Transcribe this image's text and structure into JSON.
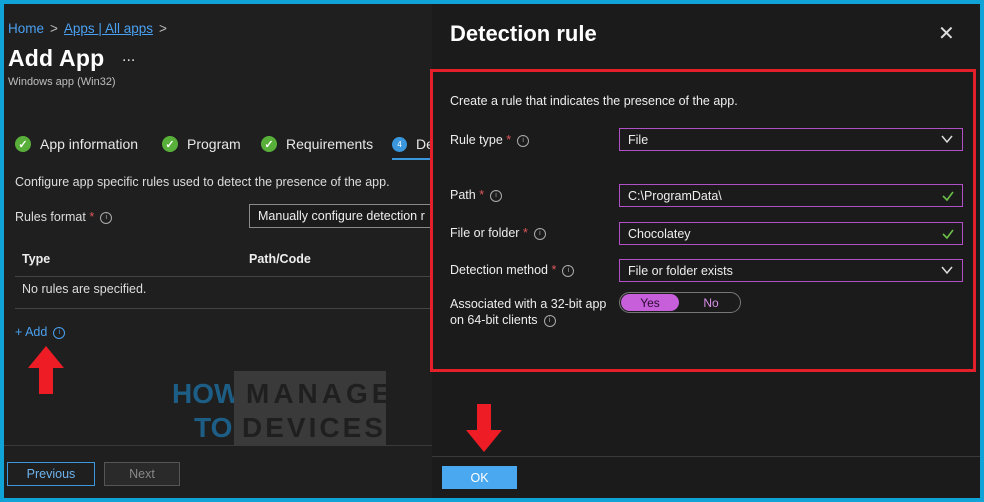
{
  "breadcrumb": {
    "home": "Home",
    "apps": "Apps | All apps",
    "sep": ">"
  },
  "page": {
    "title": "Add App",
    "more": "...",
    "subtitle": "Windows app (Win32)"
  },
  "steps": [
    {
      "label": "App information",
      "state": "done"
    },
    {
      "label": "Program",
      "state": "done"
    },
    {
      "label": "Requirements",
      "state": "done"
    },
    {
      "number": "4",
      "label": "De",
      "state": "current"
    }
  ],
  "main": {
    "description": "Configure app specific rules used to detect the presence of the app.",
    "rules_format_label": "Rules format",
    "rules_format_value": "Manually configure detection r",
    "table_headers": [
      "Type",
      "Path/Code"
    ],
    "empty_text": "No rules are specified.",
    "add_label": "+ Add"
  },
  "logo": {
    "word1_a": "HOW",
    "word1_b": "TO",
    "word2_a": "MANAGE",
    "word2_b": "DEVICES"
  },
  "footer": {
    "previous": "Previous",
    "next": "Next"
  },
  "panel": {
    "title": "Detection rule",
    "close": "✕",
    "intro": "Create a rule that indicates the presence of the app.",
    "rule_type_label": "Rule type",
    "rule_type_value": "File",
    "path_label": "Path",
    "path_value": "C:\\ProgramData\\",
    "file_label": "File or folder",
    "file_value": "Chocolatey",
    "method_label": "Detection method",
    "method_value": "File or folder exists",
    "assoc_label_1": "Associated with a 32-bit app",
    "assoc_label_2": "on 64-bit clients",
    "toggle_yes": "Yes",
    "toggle_no": "No",
    "toggle_selected": "Yes",
    "ok": "OK"
  },
  "colors": {
    "accent": "#3a96dd",
    "required": "#e0565b",
    "highlight": "#e5202a",
    "toggle": "#c65fd9",
    "success": "#58b03a"
  },
  "icons": [
    "check-circle-icon",
    "info-icon",
    "chevron-down-icon",
    "checkmark-icon",
    "close-icon",
    "arrow-up-icon",
    "arrow-down-icon"
  ]
}
